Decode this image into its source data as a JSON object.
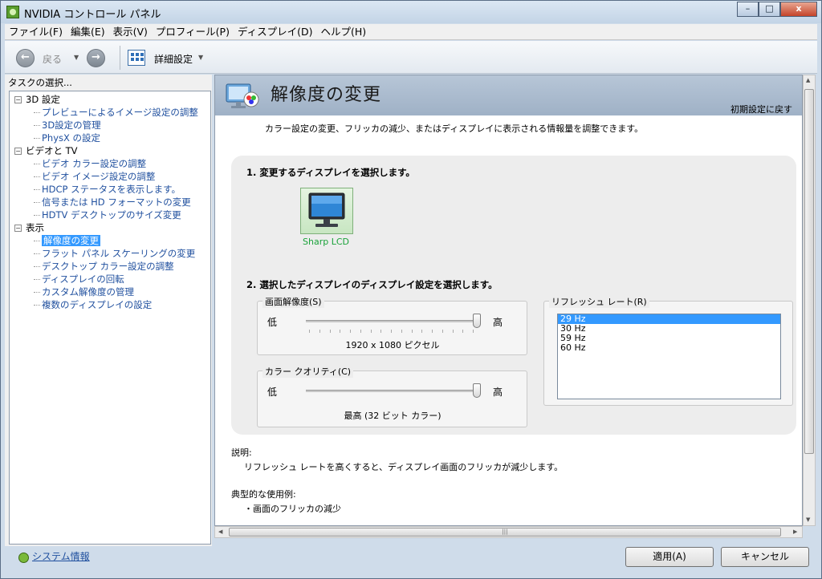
{
  "window": {
    "title": "NVIDIA コントロール パネル",
    "controls": {
      "minimize": "–",
      "maximize": "□",
      "close": "x"
    }
  },
  "menu": [
    "ファイル(F)",
    "編集(E)",
    "表示(V)",
    "プロフィール(P)",
    "ディスプレイ(D)",
    "ヘルプ(H)"
  ],
  "toolbar": {
    "back_label": "戻る",
    "advanced_label": "詳細設定"
  },
  "sidebar": {
    "task_label": "タスクの選択...",
    "categories": [
      {
        "label": "3D 設定",
        "items": [
          "プレビューによるイメージ設定の調整",
          "3D設定の管理",
          "PhysX の設定"
        ]
      },
      {
        "label": "ビデオと TV",
        "items": [
          "ビデオ カラー設定の調整",
          "ビデオ イメージ設定の調整",
          "HDCP ステータスを表示します。",
          "信号または HD フォーマットの変更",
          "HDTV デスクトップのサイズ変更"
        ]
      },
      {
        "label": "表示",
        "items": [
          "解像度の変更",
          "フラット パネル スケーリングの変更",
          "デスクトップ カラー設定の調整",
          "ディスプレイの回転",
          "カスタム解像度の管理",
          "複数のディスプレイの設定"
        ]
      }
    ],
    "active_item": "解像度の変更",
    "system_info": "システム情報"
  },
  "page": {
    "title": "解像度の変更",
    "restore_defaults": "初期設定に戻す",
    "intro": "カラー設定の変更、フリッカの減少、またはディスプレイに表示される情報量を調整できます。",
    "step1": "1. 変更するディスプレイを選択します。",
    "display_name": "Sharp LCD",
    "step2": "2. 選択したディスプレイのディスプレイ設定を選択します。",
    "resolution": {
      "legend": "画面解像度(S)",
      "low": "低",
      "high": "高",
      "value": "1920 x 1080 ピクセル",
      "level": 1.0
    },
    "color_quality": {
      "legend": "カラー クオリティ(C)",
      "low": "低",
      "high": "高",
      "value": "最高 (32 ビット カラー)",
      "level": 1.0
    },
    "refresh": {
      "legend": "リフレッシュ レート(R)",
      "options": [
        "29 Hz",
        "30 Hz",
        "59 Hz",
        "60 Hz"
      ],
      "selected": "29 Hz"
    },
    "description_label": "説明:",
    "description_text": "リフレッシュ レートを高くすると、ディスプレイ画面のフリッカが減少します。",
    "usage_label": "典型的な使用例:",
    "usage_text": "・画面のフリッカの減少"
  },
  "buttons": {
    "apply": "適用(A)",
    "cancel": "キャンセル"
  },
  "colors": {
    "link": "#1f4f9e",
    "selection": "#3399ff",
    "header": "#a9b9cc"
  }
}
